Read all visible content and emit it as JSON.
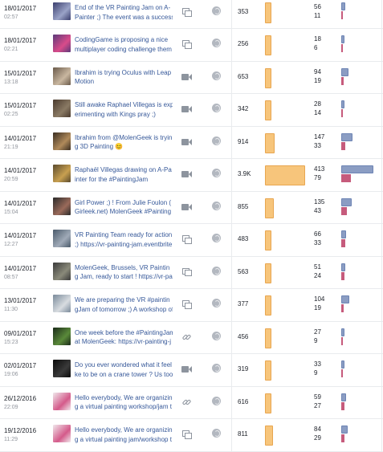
{
  "posts": [
    {
      "date": "18/01/2017",
      "time": "02:57",
      "message_line1": "End of the VR Painting Jam on A-",
      "message_line2": "Painter ;) The event was a success",
      "type_icon": "photo-icon",
      "privacy_icon": "globe-icon",
      "reach": "353",
      "reach_value": 353,
      "engagement_clicks": "56",
      "engagement_reactions": "11",
      "clicks_value": 56,
      "reactions_value": 11,
      "thumb_colors": [
        "#3b3f6e",
        "#9aa3c7"
      ]
    },
    {
      "date": "18/01/2017",
      "time": "02:21",
      "message_line1": "CodingGame is proposing a nice",
      "message_line2": "multiplayer coding challenge them",
      "type_icon": "photo-icon",
      "privacy_icon": "globe-icon",
      "reach": "256",
      "reach_value": 256,
      "engagement_clicks": "18",
      "engagement_reactions": "6",
      "clicks_value": 18,
      "reactions_value": 6,
      "thumb_colors": [
        "#5b3a7a",
        "#d94b8a"
      ]
    },
    {
      "date": "15/01/2017",
      "time": "13:18",
      "message_line1": "Ibrahim is trying Oculus with Leap",
      "message_line2": "Motion",
      "type_icon": "video-icon",
      "privacy_icon": "globe-icon",
      "reach": "653",
      "reach_value": 653,
      "engagement_clicks": "94",
      "engagement_reactions": "19",
      "clicks_value": 94,
      "reactions_value": 19,
      "thumb_colors": [
        "#6a5a4a",
        "#c9b7a0"
      ]
    },
    {
      "date": "15/01/2017",
      "time": "02:25",
      "message_line1": "Still awake Raphael Villegas is exp",
      "message_line2": "erimenting with Kings pray ;)",
      "type_icon": "video-icon",
      "privacy_icon": "globe-icon",
      "reach": "342",
      "reach_value": 342,
      "engagement_clicks": "28",
      "engagement_reactions": "14",
      "clicks_value": 28,
      "reactions_value": 14,
      "thumb_colors": [
        "#4a3a2e",
        "#8a7a64"
      ]
    },
    {
      "date": "14/01/2017",
      "time": "21:19",
      "message_line1": "Ibrahim from @MolenGeek is tryin",
      "message_line2": "g 3D Painting 😊",
      "type_icon": "video-icon",
      "privacy_icon": "globe-icon",
      "reach": "914",
      "reach_value": 914,
      "engagement_clicks": "147",
      "engagement_reactions": "33",
      "clicks_value": 147,
      "reactions_value": 33,
      "thumb_colors": [
        "#3a2e22",
        "#b08a5a"
      ]
    },
    {
      "date": "14/01/2017",
      "time": "20:59",
      "message_line1": "Raphaël Villegas drawing on A-Pa",
      "message_line2": "inter for the #PaintingJam",
      "type_icon": "video-icon",
      "privacy_icon": "globe-icon",
      "reach": "3.9K",
      "reach_value": 3900,
      "engagement_clicks": "413",
      "engagement_reactions": "79",
      "clicks_value": 413,
      "reactions_value": 79,
      "thumb_colors": [
        "#5a4a2e",
        "#c8a050"
      ]
    },
    {
      "date": "14/01/2017",
      "time": "15:04",
      "message_line1": "Girl Power ;) ! From Julie Foulon (",
      "message_line2": "Girleek.net) MolenGeek #Painting",
      "type_icon": "video-icon",
      "privacy_icon": "globe-icon",
      "reach": "855",
      "reach_value": 855,
      "engagement_clicks": "135",
      "engagement_reactions": "43",
      "clicks_value": 135,
      "reactions_value": 43,
      "thumb_colors": [
        "#2a2a2a",
        "#9a6a5a"
      ]
    },
    {
      "date": "14/01/2017",
      "time": "12:27",
      "message_line1": "VR Painting Team ready for action",
      "message_line2": ";) https://vr-painting-jam.eventbrite.",
      "type_icon": "photo-icon",
      "privacy_icon": "globe-icon",
      "reach": "483",
      "reach_value": 483,
      "engagement_clicks": "66",
      "engagement_reactions": "33",
      "clicks_value": 66,
      "reactions_value": 33,
      "thumb_colors": [
        "#4a5a6a",
        "#a0aab8"
      ]
    },
    {
      "date": "14/01/2017",
      "time": "08:57",
      "message_line1": "MolenGeek, Brussels, VR Paintin",
      "message_line2": "g Jam, ready to start ! https://vr-pai",
      "type_icon": "photo-icon",
      "privacy_icon": "globe-icon",
      "reach": "563",
      "reach_value": 563,
      "engagement_clicks": "51",
      "engagement_reactions": "24",
      "clicks_value": 51,
      "reactions_value": 24,
      "thumb_colors": [
        "#3a3a3a",
        "#8a8a7a"
      ]
    },
    {
      "date": "13/01/2017",
      "time": "11:30",
      "message_line1": "We are preparing the VR #paintin",
      "message_line2": "gJam of tomorrow ;) A workshop of",
      "type_icon": "photo-icon",
      "privacy_icon": "globe-icon",
      "reach": "377",
      "reach_value": 377,
      "engagement_clicks": "104",
      "engagement_reactions": "19",
      "clicks_value": 104,
      "reactions_value": 19,
      "thumb_colors": [
        "#7a8a9a",
        "#d8dce0"
      ]
    },
    {
      "date": "09/01/2017",
      "time": "15:23",
      "message_line1": "One week before the #PaintingJam",
      "message_line2": "at MolenGeek: https://vr-painting-j",
      "type_icon": "link-icon",
      "privacy_icon": "globe-icon",
      "reach": "456",
      "reach_value": 456,
      "engagement_clicks": "27",
      "engagement_reactions": "9",
      "clicks_value": 27,
      "reactions_value": 9,
      "thumb_colors": [
        "#1a2a1a",
        "#5a8a3a"
      ]
    },
    {
      "date": "02/01/2017",
      "time": "19:06",
      "message_line1": "Do you ever wondered what it feel li",
      "message_line2": "ke to be on a crane tower ? Us too",
      "type_icon": "video-icon",
      "privacy_icon": "globe-icon",
      "reach": "319",
      "reach_value": 319,
      "engagement_clicks": "33",
      "engagement_reactions": "9",
      "clicks_value": 33,
      "reactions_value": 9,
      "thumb_colors": [
        "#0a0a0a",
        "#3a3a3a"
      ]
    },
    {
      "date": "26/12/2016",
      "time": "22:09",
      "message_line1": "Hello everybody, We are organizin",
      "message_line2": "g a virtual painting workshop/jam t",
      "type_icon": "link-icon",
      "privacy_icon": "globe-icon",
      "reach": "616",
      "reach_value": 616,
      "engagement_clicks": "59",
      "engagement_reactions": "27",
      "clicks_value": 59,
      "reactions_value": 27,
      "thumb_colors": [
        "#f0e8ec",
        "#d45a8a"
      ]
    },
    {
      "date": "19/12/2016",
      "time": "11:29",
      "message_line1": "Hello everybody, We are organizin",
      "message_line2": "g a virtual painting jam/workshop t",
      "type_icon": "photo-icon",
      "privacy_icon": "globe-icon",
      "reach": "811",
      "reach_value": 811,
      "engagement_clicks": "84",
      "engagement_reactions": "29",
      "clicks_value": 84,
      "reactions_value": 29,
      "thumb_colors": [
        "#f0e8ec",
        "#d45a8a"
      ]
    }
  ],
  "colors": {
    "reach_bar": "#f7c57b",
    "clicks_bar": "#8b9dc3",
    "reactions_bar": "#c65b7c",
    "link_text": "#365899",
    "muted_text": "#90949c"
  },
  "scales": {
    "reach_max": 3900,
    "clicks_max": 413,
    "reactions_max": 79
  }
}
